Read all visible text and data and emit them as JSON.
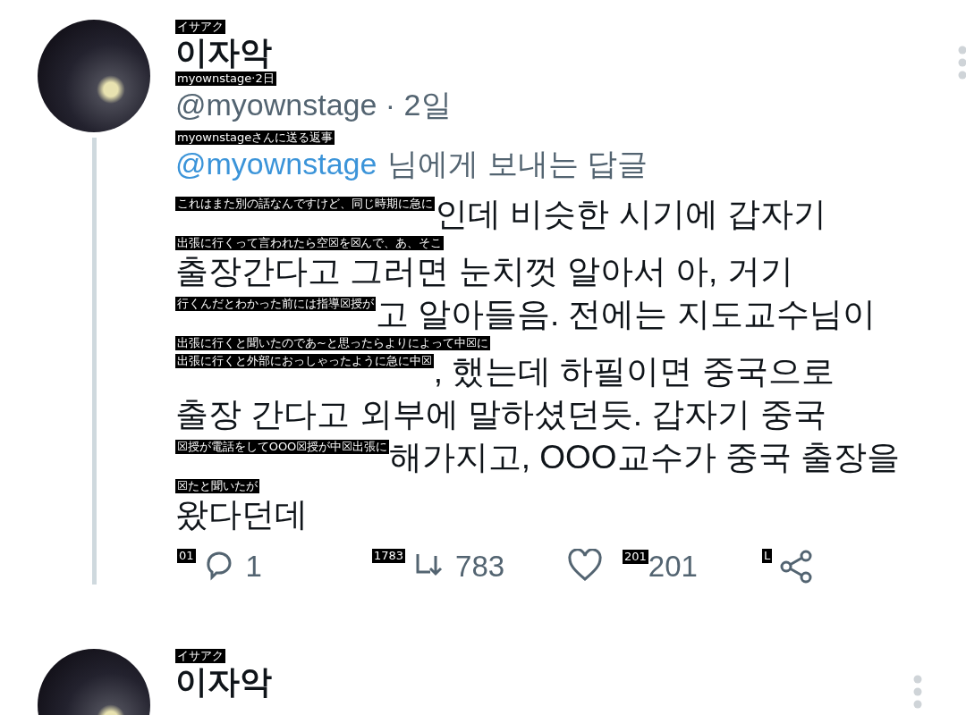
{
  "tweets": [
    {
      "name": "이자악",
      "name_gloss": "イサアク",
      "handle": "@myownstage · 2일",
      "handle_gloss": "myownstage·2日",
      "thread_line": true,
      "reply_to": {
        "gloss": "myownstageさんに送る返事",
        "mention": "@myownstage",
        "text": "님에게 보내는 답글"
      },
      "body": [
        {
          "kind": "line",
          "gloss": "これはまた別の話なんですけど、同じ時期に急に",
          "text": "인데 비슷한 시기에 갑자기"
        },
        {
          "kind": "gloss",
          "text": "出張に行くって言われたら空☒を☒んで、あ、そこ"
        },
        {
          "kind": "line",
          "text": "출장간다고 그러면 눈치껏 알아서 아, 거기"
        },
        {
          "kind": "line",
          "gloss": "行くんだとわかった前には指導☒授が",
          "text": "고 알아들음. 전에는 지도교수님이"
        },
        {
          "kind": "gloss",
          "text": "出張に行くと聞いたのであ~と思ったらよりによって中☒に"
        },
        {
          "kind": "line",
          "gloss": "出張に行くと外部におっしゃったように急に中☒",
          "text": ", 했는데 하필이면 중국으로"
        },
        {
          "kind": "line",
          "text": "출장 간다고 외부에 말하셨던듯. 갑자기 중국"
        },
        {
          "kind": "line",
          "gloss": "☒授が電話をしてOOO☒授が中☒出張に",
          "text": "해가지고, OOO교수가 중국 출장을"
        },
        {
          "kind": "gloss",
          "text": "☒たと聞いたが"
        },
        {
          "kind": "line",
          "text": "왔다던데"
        }
      ],
      "actions": [
        {
          "kind": "reply",
          "gloss": "01",
          "count": "1"
        },
        {
          "kind": "retweet",
          "gloss": "1783",
          "count": "783"
        },
        {
          "kind": "like",
          "gloss": "201",
          "count": "201"
        },
        {
          "kind": "share",
          "gloss": "L"
        }
      ]
    },
    {
      "name": "이자악",
      "name_gloss": "イサアク",
      "thread_line": false
    }
  ]
}
